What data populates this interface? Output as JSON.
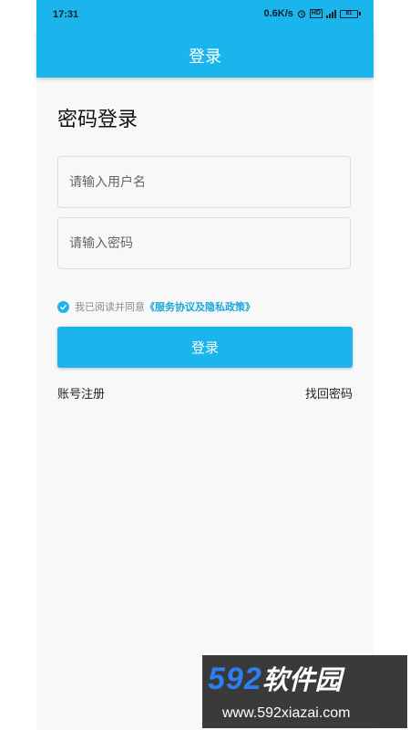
{
  "status_bar": {
    "time": "17:31",
    "network_speed": "0.6K/s",
    "alarm_icon": "alarm-icon",
    "hd_badge": "HD",
    "battery": "81"
  },
  "app_bar": {
    "title": "登录"
  },
  "login": {
    "heading": "密码登录",
    "username_placeholder": "请输入用户名",
    "password_placeholder": "请输入密码",
    "agree_text": "我已阅读并同意",
    "agree_link": "《服务协议及隐私政策》",
    "agree_checked": true,
    "login_button": "登录",
    "register_link": "账号注册",
    "recover_link": "找回密码"
  },
  "watermark": {
    "number": "592",
    "text": "软件园",
    "url": "www.592xiazai.com"
  },
  "colors": {
    "accent": "#1bb5ee",
    "link": "#1aa6dc",
    "background": "#f8f8f8"
  }
}
